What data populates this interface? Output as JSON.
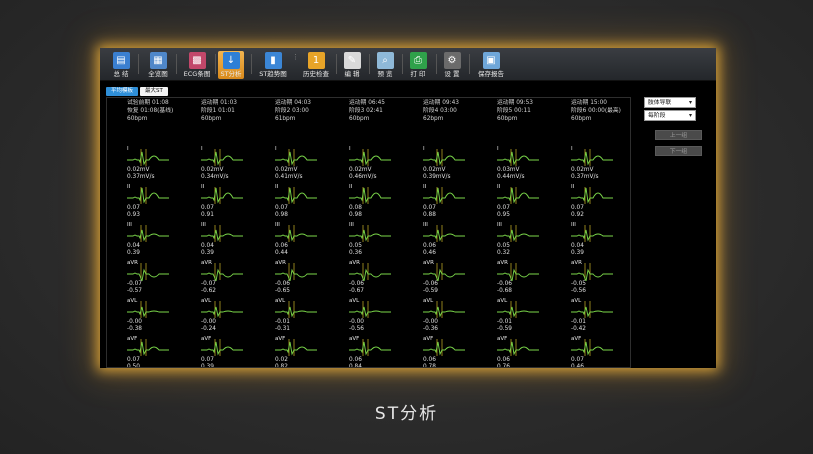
{
  "toolbar": {
    "buttons": [
      {
        "label": "总 结",
        "icon": "summary-icon",
        "glyph": "▤",
        "color": "#3a7fd0"
      },
      {
        "label": "全览图",
        "icon": "overview-icon",
        "glyph": "▦",
        "color": "#4f87c9"
      },
      {
        "label": "ECG条图",
        "icon": "ecg-strip-icon",
        "glyph": "▩",
        "color": "#c2476a"
      },
      {
        "label": "ST分析",
        "icon": "st-analysis-icon",
        "glyph": "↓",
        "color": "#2e7fd6"
      },
      {
        "label": "ST趋势图",
        "icon": "st-trend-icon",
        "glyph": "▮",
        "color": "#3b86d6"
      },
      {
        "label": "历史检查",
        "icon": "history-icon",
        "glyph": "1",
        "color": "#e8a428"
      },
      {
        "label": "编 辑",
        "icon": "edit-icon",
        "glyph": "✎",
        "color": "#d9d9d9"
      },
      {
        "label": "预 览",
        "icon": "preview-icon",
        "glyph": "⌕",
        "color": "#8fb9d8"
      },
      {
        "label": "打 印",
        "icon": "print-icon",
        "glyph": "⎙",
        "color": "#2fa14a"
      },
      {
        "label": "设 置",
        "icon": "settings-icon",
        "glyph": "⚙",
        "color": "#6b6b6b"
      },
      {
        "label": "保存报告",
        "icon": "save-report-icon",
        "glyph": "▣",
        "color": "#6fa7d9"
      }
    ]
  },
  "tabs": [
    "平均模板",
    "最大ST"
  ],
  "columns": [
    {
      "head": [
        "试验前期 01:08",
        "恢复 01:08(基线)",
        "60bpm"
      ],
      "leads": [
        [
          "0.02mV",
          "0.37mV/s"
        ],
        [
          "0.07",
          "0.93"
        ],
        [
          "0.04",
          "0.39"
        ],
        [
          "-0.07",
          "-0.57"
        ],
        [
          "-0.00",
          "-0.38"
        ],
        [
          "0.07",
          "0.50"
        ]
      ]
    },
    {
      "head": [
        "运动期 01:03",
        "阶段1 01:01",
        "60bpm"
      ],
      "leads": [
        [
          "0.02mV",
          "0.34mV/s"
        ],
        [
          "0.07",
          "0.91"
        ],
        [
          "0.04",
          "0.39"
        ],
        [
          "-0.07",
          "-0.62"
        ],
        [
          "-0.00",
          "-0.24"
        ],
        [
          "0.07",
          "0.39"
        ]
      ]
    },
    {
      "head": [
        "运动期 04:03",
        "阶段2 03:00",
        "61bpm"
      ],
      "leads": [
        [
          "0.02mV",
          "0.41mV/s"
        ],
        [
          "0.07",
          "0.98"
        ],
        [
          "0.06",
          "0.44"
        ],
        [
          "-0.06",
          "-0.65"
        ],
        [
          "-0.01",
          "-0.31"
        ],
        [
          "0.02",
          "0.82"
        ]
      ]
    },
    {
      "head": [
        "运动期 06:45",
        "阶段3 02:41",
        "60bpm"
      ],
      "leads": [
        [
          "0.02mV",
          "0.46mV/s"
        ],
        [
          "0.08",
          "0.98"
        ],
        [
          "0.05",
          "0.36"
        ],
        [
          "-0.06",
          "-0.67"
        ],
        [
          "-0.00",
          "-0.56"
        ],
        [
          "0.06",
          "0.84"
        ]
      ]
    },
    {
      "head": [
        "运动期 09:43",
        "阶段4 03:00",
        "62bpm"
      ],
      "leads": [
        [
          "0.02mV",
          "0.39mV/s"
        ],
        [
          "0.07",
          "0.88"
        ],
        [
          "0.06",
          "0.46"
        ],
        [
          "-0.06",
          "-0.59"
        ],
        [
          "-0.00",
          "-0.36"
        ],
        [
          "0.06",
          "0.78"
        ]
      ]
    },
    {
      "head": [
        "运动期 09:53",
        "阶段5 00:11",
        "60bpm"
      ],
      "leads": [
        [
          "0.03mV",
          "0.44mV/s"
        ],
        [
          "0.07",
          "0.95"
        ],
        [
          "0.05",
          "0.32"
        ],
        [
          "-0.06",
          "-0.68"
        ],
        [
          "-0.01",
          "-0.59"
        ],
        [
          "0.06",
          "0.76"
        ]
      ]
    },
    {
      "head": [
        "运动期 15:00",
        "阶段6 00:00(最高)",
        "60bpm"
      ],
      "leads": [
        [
          "0.02mV",
          "0.37mV/s"
        ],
        [
          "0.07",
          "0.92"
        ],
        [
          "0.04",
          "0.39"
        ],
        [
          "-0.05",
          "-0.56"
        ],
        [
          "-0.01",
          "-0.42"
        ],
        [
          "0.07",
          "0.46"
        ]
      ]
    }
  ],
  "lead_names": [
    "I",
    "II",
    "III",
    "aVR",
    "aVL",
    "aVF"
  ],
  "side": {
    "lead_select": "肢体导联",
    "stage_select": "每阶段",
    "prev_group": "上一组",
    "next_group": "下一组"
  },
  "caption": "ST分析",
  "colors": {
    "ecg_trace": "#7bd84a",
    "ecg_marker": "#f0d830",
    "accent_glow": "#ffbe3c",
    "active_tab": "#2f8fd8"
  }
}
